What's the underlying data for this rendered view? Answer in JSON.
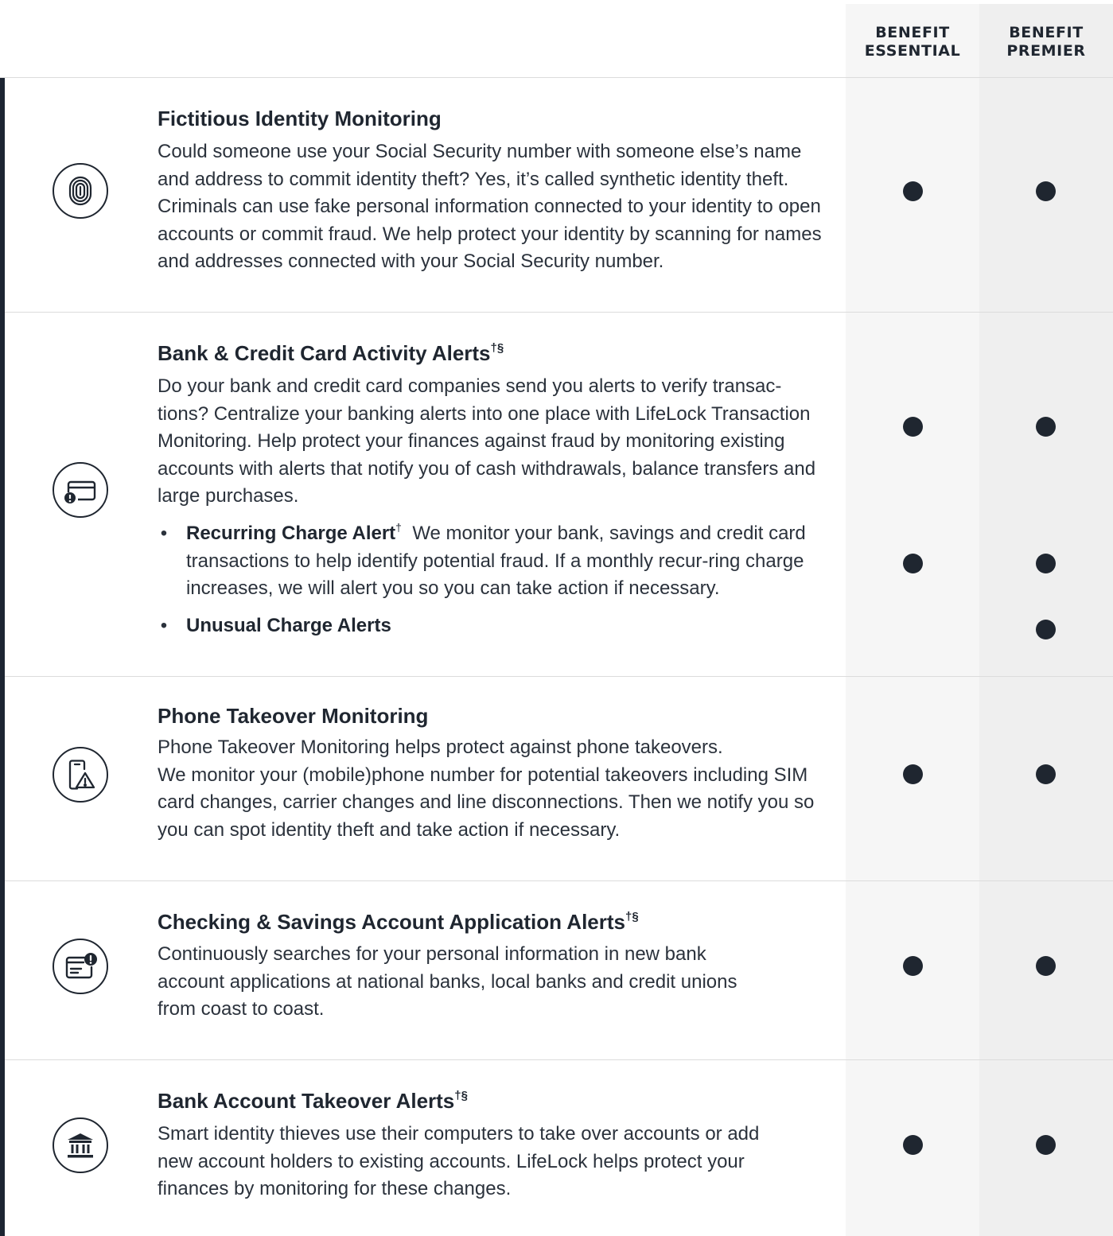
{
  "columns": {
    "essential": "BENEFIT\nESSENTIAL",
    "premier": "BENEFIT\nPREMIER"
  },
  "features": [
    {
      "icon": "fingerprint-icon",
      "title": "Fictitious Identity Monitoring",
      "title_sup": "",
      "description": "Could someone use your Social Security number with someone else’s name and address to commit identity theft? Yes, it’s called synthetic identity theft. Criminals can use fake personal information connected to your identity to open accounts or commit fraud. We help protect your identity by scanning for names and addresses connected with your Social Security number.",
      "essential": true,
      "premier": true
    },
    {
      "icon": "credit-card-alert-icon",
      "title": "Bank & Credit Card Activity Alerts",
      "title_sup": "†§",
      "description": "Do your bank and credit card companies send you alerts to verify transac-tions? Centralize your banking alerts into one place with LifeLock Transaction Monitoring. Help protect your finances against fraud by monitoring existing accounts with alerts that notify you of cash withdrawals, balance transfers and large purchases.",
      "essential": true,
      "premier": true,
      "sub_items": [
        {
          "title": "Recurring Charge Alert",
          "title_sup": "†",
          "description": "We monitor your bank, savings and credit card transactions to help identify potential fraud. If a monthly recur-ring charge increases, we will alert you so you can take action if necessary.",
          "essential": true,
          "premier": true
        },
        {
          "title": "Unusual Charge Alerts",
          "title_sup": "",
          "description": "",
          "essential": false,
          "premier": true
        }
      ]
    },
    {
      "icon": "phone-warning-icon",
      "title": "Phone Takeover Monitoring",
      "title_sup": "",
      "description": "Phone Takeover Monitoring helps protect against phone takeovers.\nWe monitor your (mobile)phone number for potential takeovers including SIM card changes, carrier changes and line disconnections. Then we notify you so you can spot identity theft and take action if necessary.",
      "essential": true,
      "premier": true
    },
    {
      "icon": "bank-application-alert-icon",
      "title": "Checking & Savings Account Application Alerts",
      "title_sup": "†§",
      "description": "Continuously searches for your personal information in new bank account applications at national banks, local banks and credit unions from coast to coast.",
      "essential": true,
      "premier": true
    },
    {
      "icon": "bank-building-icon",
      "title": "Bank Account Takeover Alerts",
      "title_sup": "†§",
      "description": "Smart identity thieves use their computers to take over accounts or add new account holders to existing accounts. LifeLock helps protect your finances by monitoring for these changes.",
      "essential": true,
      "premier": true
    }
  ],
  "bullet_char": "•",
  "colors": {
    "text": "#1f2630",
    "left_bar": "#1d2532",
    "essential_bg": "#f6f6f6",
    "premier_bg": "#efefef",
    "divider": "#dcdcdc"
  }
}
